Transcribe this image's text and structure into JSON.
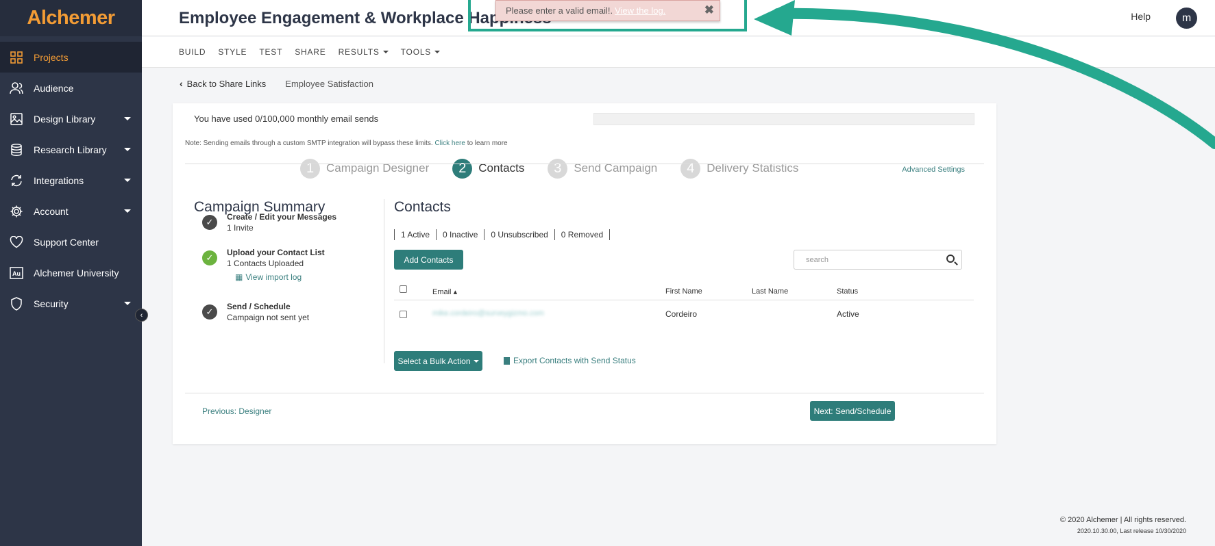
{
  "brand": {
    "name": "Alchemer",
    "accent": "#f39c35",
    "teal": "#2e7d7a",
    "sidebar_bg": "#2d3547"
  },
  "sidebar": {
    "items": [
      {
        "label": "Projects",
        "icon": "grid-icon",
        "active": true,
        "dropdown": false
      },
      {
        "label": "Audience",
        "icon": "user-icon",
        "active": false,
        "dropdown": false
      },
      {
        "label": "Design Library",
        "icon": "image-icon",
        "active": false,
        "dropdown": true
      },
      {
        "label": "Research Library",
        "icon": "database-icon",
        "active": false,
        "dropdown": true
      },
      {
        "label": "Integrations",
        "icon": "refresh-icon",
        "active": false,
        "dropdown": true
      },
      {
        "label": "Account",
        "icon": "gear-icon",
        "active": false,
        "dropdown": true
      },
      {
        "label": "Support Center",
        "icon": "heart-icon",
        "active": false,
        "dropdown": false
      },
      {
        "label": "Alchemer University",
        "icon": "au-icon",
        "active": false,
        "dropdown": false
      },
      {
        "label": "Security",
        "icon": "shield-icon",
        "active": false,
        "dropdown": true
      }
    ]
  },
  "header": {
    "title": "Employee Engagement & Workplace Happiness",
    "help": "Help",
    "avatar_letter": "m"
  },
  "subnav": {
    "items": [
      "BUILD",
      "STYLE",
      "TEST",
      "SHARE",
      "RESULTS",
      "TOOLS"
    ]
  },
  "breadcrumb": {
    "back": "Back to Share Links",
    "current": "Employee Satisfaction"
  },
  "usage": {
    "text": "You have used 0/100,000 monthly email sends",
    "fraction": 0
  },
  "note": {
    "text": "Note: Sending emails through a custom SMTP integration will bypass these limits.",
    "link": "Click here",
    "suffix": "to learn more"
  },
  "steps": [
    {
      "num": "1",
      "label": "Campaign Designer"
    },
    {
      "num": "2",
      "label": "Contacts"
    },
    {
      "num": "3",
      "label": "Send Campaign"
    },
    {
      "num": "4",
      "label": "Delivery Statistics"
    }
  ],
  "advanced_settings": "Advanced Settings",
  "summary": {
    "title": "Campaign Summary",
    "items": [
      {
        "title": "Create / Edit your Messages",
        "sub": "1 Invite"
      },
      {
        "title": "Upload your Contact List",
        "sub": "1 Contacts Uploaded",
        "link": "View import log"
      },
      {
        "title": "Send / Schedule",
        "sub": "Campaign not sent yet"
      }
    ]
  },
  "contacts": {
    "title": "Contacts",
    "filters": [
      "1 Active",
      "0 Inactive",
      "0 Unsubscribed",
      "0 Removed"
    ],
    "add_button": "Add Contacts",
    "search_placeholder": "search",
    "columns": [
      "Email",
      "First Name",
      "Last Name",
      "Status"
    ],
    "rows": [
      {
        "email": "mike.cordeiro@surveygizmo.com",
        "first": "Cordeiro",
        "last": "",
        "status": "Active"
      }
    ],
    "bulk_action": "Select a Bulk Action",
    "export": "Export Contacts with Send Status"
  },
  "nav_buttons": {
    "prev": "Previous: Designer",
    "next": "Next: Send/Schedule"
  },
  "footer": {
    "copyright": "© 2020 Alchemer | All rights reserved.",
    "release": "2020.10.30.00, Last release 10/30/2020"
  },
  "alert": {
    "message": "Please enter a valid email!.",
    "link": "View the log."
  }
}
